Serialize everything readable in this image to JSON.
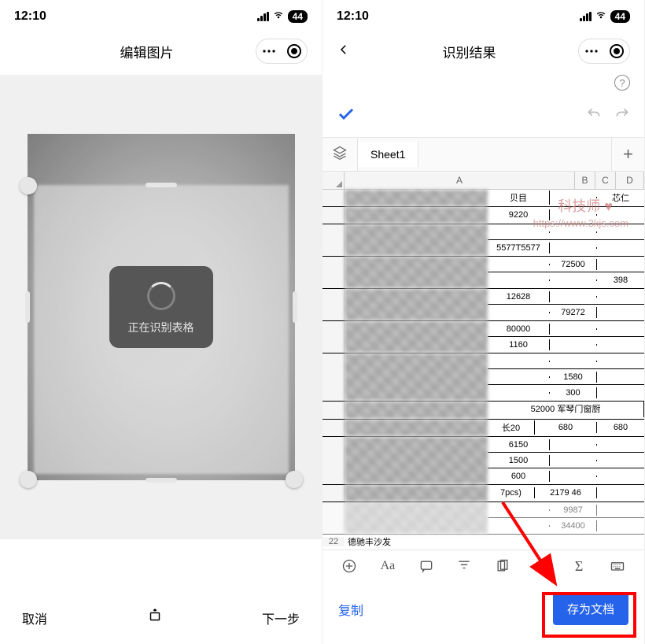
{
  "status": {
    "time": "12:10",
    "battery": "44"
  },
  "left": {
    "title": "编辑图片",
    "loading_text": "正在识别表格",
    "cancel": "取消",
    "next": "下一步"
  },
  "right": {
    "title": "识别结果",
    "sheet_name": "Sheet1",
    "col_headers": [
      "A",
      "B",
      "C",
      "D"
    ],
    "header_row": {
      "a": "贝目",
      "d": "芯仁"
    },
    "rows": [
      {
        "lines": [
          {
            "v": [
              "9220",
              "",
              ""
            ]
          }
        ]
      },
      {
        "lines": [
          {
            "v": [
              "",
              "",
              ""
            ]
          },
          {
            "v": [
              "5577T5577",
              "",
              ""
            ]
          }
        ]
      },
      {
        "lines": [
          {
            "v": [
              "",
              "72500",
              ""
            ]
          },
          {
            "v": [
              "",
              "",
              "398"
            ]
          }
        ]
      },
      {
        "lines": [
          {
            "v": [
              "12628",
              "",
              ""
            ]
          },
          {
            "v": [
              "",
              "79272",
              ""
            ]
          }
        ]
      },
      {
        "lines": [
          {
            "v": [
              "80000",
              "",
              ""
            ]
          },
          {
            "v": [
              "1160",
              "",
              ""
            ]
          }
        ]
      },
      {
        "lines": [
          {
            "v": [
              "",
              "",
              ""
            ]
          },
          {
            "v": [
              "",
              "1580",
              ""
            ]
          },
          {
            "v": [
              "",
              "300",
              ""
            ]
          }
        ]
      },
      {
        "lines": [
          {
            "v": [
              "52000 军琴门窗厨",
              "",
              ""
            ],
            "span": true
          }
        ]
      },
      {
        "lines": [
          {
            "v": [
              "长20",
              "680",
              "680"
            ],
            "prefix": true
          }
        ]
      },
      {
        "lines": [
          {
            "v": [
              "6150",
              "",
              ""
            ]
          },
          {
            "v": [
              "1500",
              "",
              ""
            ]
          },
          {
            "v": [
              "600",
              "",
              ""
            ]
          }
        ]
      },
      {
        "lines": [
          {
            "v": [
              "7pcs)",
              "2179 46",
              ""
            ],
            "prefix": true
          }
        ]
      },
      {
        "lines": [
          {
            "v": [
              "",
              "9987",
              ""
            ]
          },
          {
            "v": [
              "",
              "34400",
              ""
            ]
          }
        ],
        "muted": true
      }
    ],
    "last_row": {
      "num": "22",
      "text": "德驰丰沙发"
    },
    "copy": "复制",
    "save": "存为文档",
    "watermark": "科技师",
    "watermark_url": "https://www.3kjs.com"
  }
}
